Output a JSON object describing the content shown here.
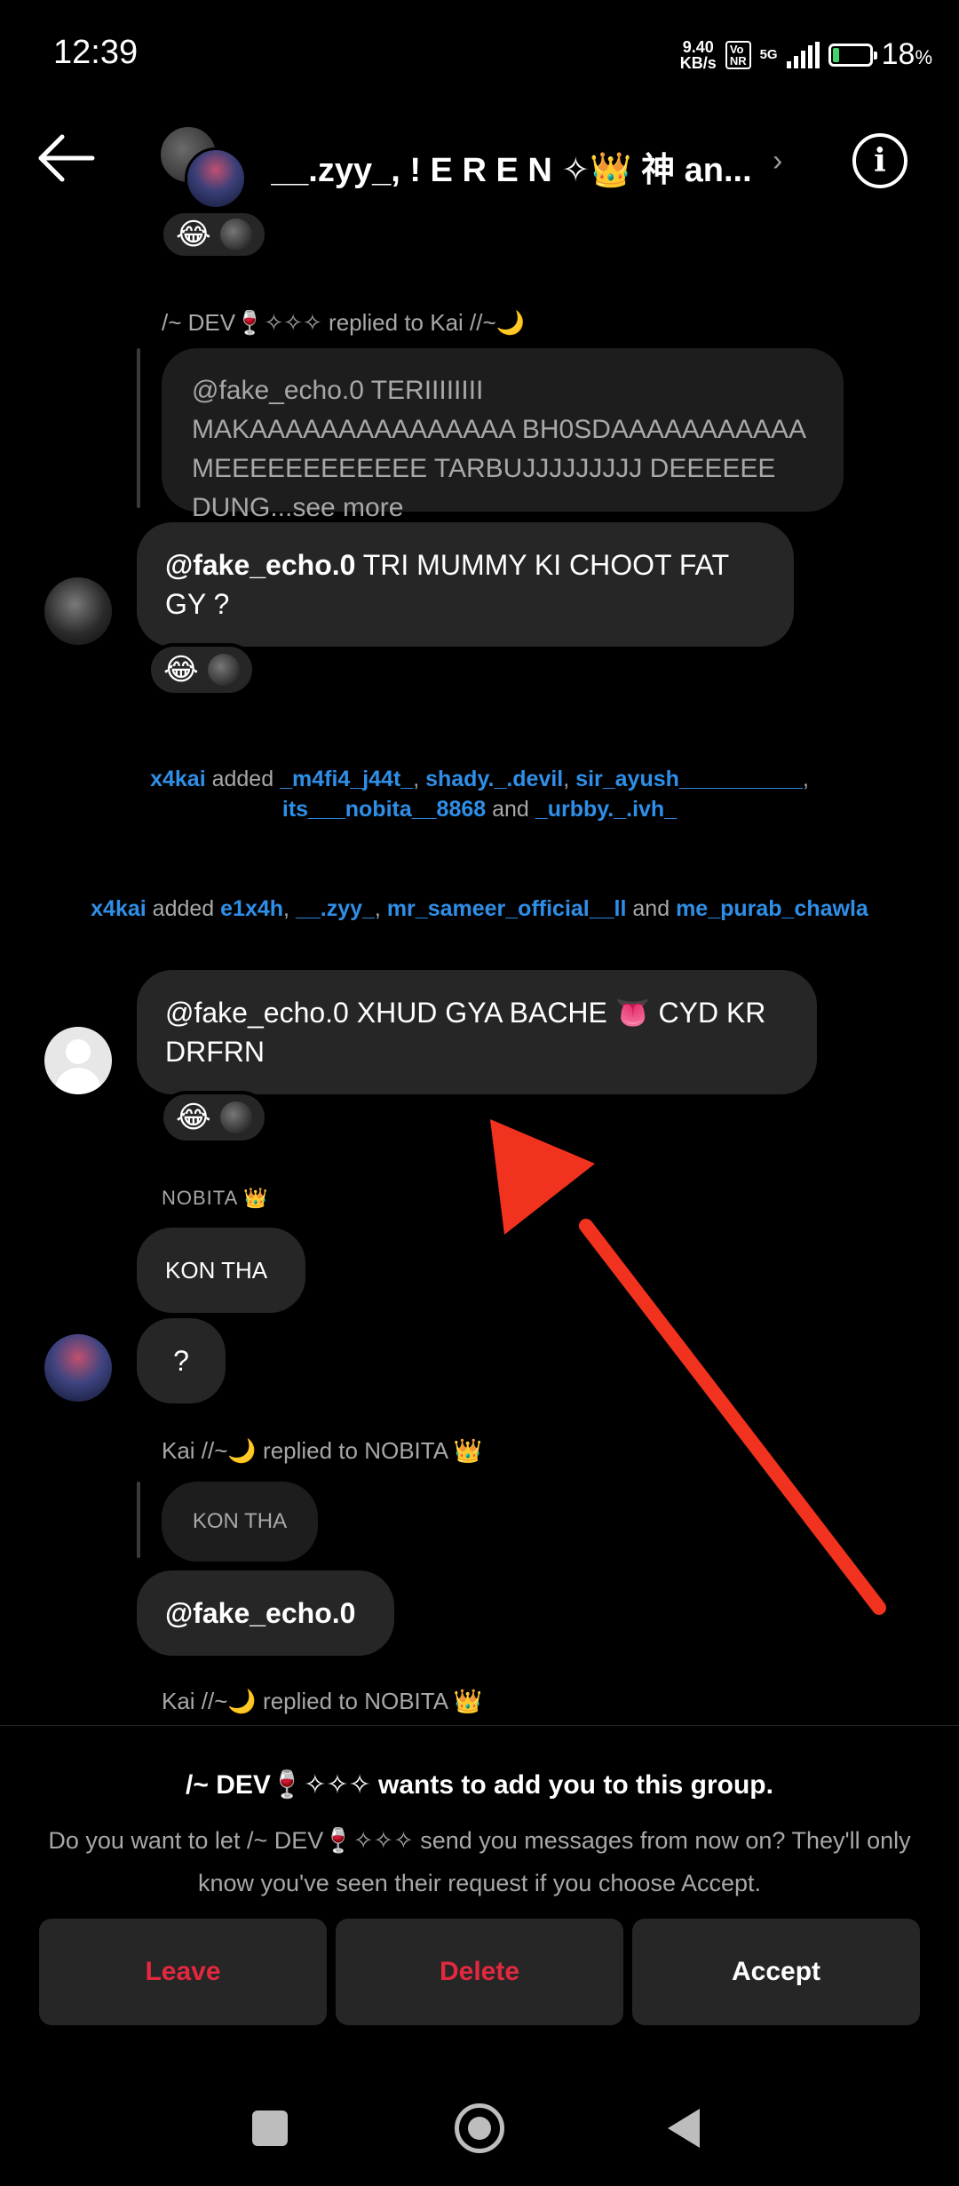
{
  "status_bar": {
    "time": "12:39",
    "speed_value": "9.40",
    "speed_unit": "KB/s",
    "vonr_top": "Vo",
    "vonr_bottom": "NR",
    "network": "5G",
    "battery_level_percent": 18,
    "battery_label": "18",
    "battery_suffix": "%"
  },
  "header": {
    "title": "__.zyy_, ! E R E N ✧👑 神 an...",
    "chevron": "›",
    "info": "i"
  },
  "messages": {
    "top_reaction": {
      "emoji": "😂"
    },
    "reply1": {
      "label": "/~ DEV🍷✧✧✧ replied to Kai //~🌙",
      "quoted": "@fake_echo.0 TERIIIIIIII MAKAAAAAAAAAAAAAAA BH0SDAAAAAAAAAAA MEEEEEEEEEEEE TARBUJJJJJJJJJ DEEEEEE DUNG...see more",
      "mention": "@fake_echo.0",
      "text": "TRI MUMMY KI CHOOT FAT GY ?",
      "reaction_emoji": "😂"
    },
    "system1": {
      "actor": "x4kai",
      "verb": "added",
      "u1": "_m4fi4_j44t_",
      "sep1": ",",
      "u2": "shady._.devil",
      "sep2": ",",
      "u3": "sir_ayush__________",
      "sep3": ",",
      "u4": "its___nobita__8868",
      "and": "and",
      "u5": "_urbby._.ivh_"
    },
    "system2": {
      "actor": "x4kai",
      "verb": "added",
      "u1": "e1x4h",
      "sep1": ",",
      "u2": "__.zyy_",
      "sep2": ",",
      "u3": "mr_sameer_official__ll",
      "and": "and",
      "u4": "me_purab_chawla"
    },
    "msg2": {
      "text": "@fake_echo.0 XHUD GYA BACHE 👅 CYD KR DRFRN",
      "reaction_emoji": "😂"
    },
    "nobita": {
      "sender": "NOBITA 👑",
      "msg1": "KON THA",
      "msg2": "?"
    },
    "reply2": {
      "label": "Kai //~🌙 replied to NOBITA 👑",
      "quoted": "KON THA",
      "text": "@fake_echo.0"
    },
    "reply3": {
      "label": "Kai //~🌙 replied to NOBITA 👑"
    }
  },
  "request": {
    "title": "/~ DEV🍷✧✧✧ wants to add you to this group.",
    "description": "Do you want to let /~ DEV🍷✧✧✧ send you messages from now on? They'll only know you've seen their request if you choose Accept.",
    "leave": "Leave",
    "delete": "Delete",
    "accept": "Accept"
  },
  "colors": {
    "background": "#000000",
    "bubble": "#262626",
    "mention_blue": "#2f8fe8",
    "danger_red": "#e3283f",
    "arrow_red": "#f0321e"
  }
}
